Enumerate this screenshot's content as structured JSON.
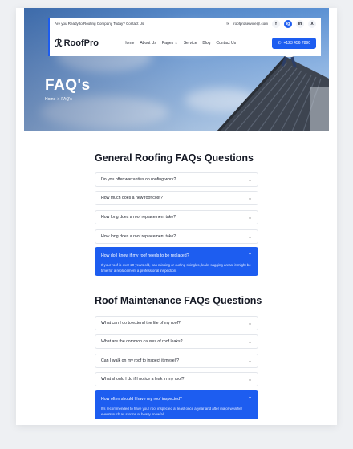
{
  "topbar": {
    "promo": "Are you Ready to Roofing Company Today? Contact Us",
    "email": "roofproservice@.com",
    "social": [
      "f",
      "ig",
      "in",
      "X"
    ]
  },
  "brand": {
    "name": "RoofPro"
  },
  "nav": {
    "items": [
      "Home",
      "About Us",
      "Pages",
      "Service",
      "Blog",
      "Contact Us"
    ],
    "phone": "+123 456 7890"
  },
  "hero": {
    "title": "FAQ's",
    "breadcrumb_home": "Home",
    "breadcrumb_sep": ">",
    "breadcrumb_current": "FAQ's"
  },
  "sections": [
    {
      "title": "General Roofing FAQs Questions",
      "items": [
        {
          "q": "Do you offer warranties on roofing work?"
        },
        {
          "q": "How much does a new roof cost?"
        },
        {
          "q": "How long does a roof replacement take?"
        },
        {
          "q": "How long does a roof replacement take?"
        },
        {
          "q": "How do I know if my roof needs to be replaced?",
          "a": "If your roof is over 20 years old, has missing or curling shingles, leaks sagging areas, it might be time for a replacement a professional inspection."
        }
      ]
    },
    {
      "title": "Roof Maintenance FAQs Questions",
      "items": [
        {
          "q": "What can I do to extend the life of my roof?"
        },
        {
          "q": "What are the common causes of roof leaks?"
        },
        {
          "q": "Can I walk on my roof to inspect it myself?"
        },
        {
          "q": "What should I do if I notice a leak in my roof?"
        },
        {
          "q": "How often should I have my roof inspected?",
          "a": "It's recommended to have your roof inspected at least once a year and after major weather events such as storms or heavy snowfall."
        }
      ]
    }
  ],
  "colors": {
    "accent": "#1d5df0",
    "heading": "#141824"
  }
}
